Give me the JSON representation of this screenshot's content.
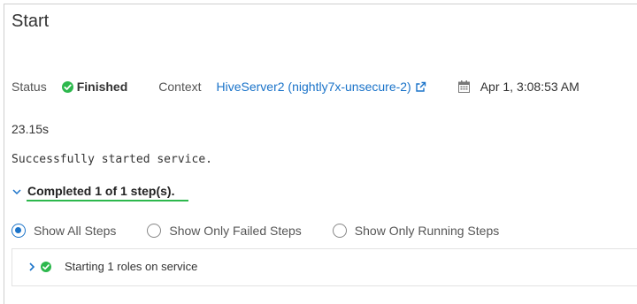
{
  "title": "Start",
  "status": {
    "label": "Status",
    "value": "Finished",
    "icon": "check-circle-icon",
    "color": "#2db84d"
  },
  "context": {
    "label": "Context",
    "link_text": "HiveServer2 (nightly7x-unsecure-2)",
    "icon": "external-link-icon",
    "link_color": "#1a73c9"
  },
  "timestamp": {
    "icon": "calendar-icon",
    "value": "Apr 1, 3:08:53 AM"
  },
  "duration": "23.15s",
  "message": "Successfully started service.",
  "completed": {
    "text": "Completed 1 of 1 step(s).",
    "expanded": true
  },
  "filters": {
    "options": [
      {
        "label": "Show All Steps",
        "checked": true
      },
      {
        "label": "Show Only Failed Steps",
        "checked": false
      },
      {
        "label": "Show Only Running Steps",
        "checked": false
      }
    ]
  },
  "steps": [
    {
      "label": "Starting 1 roles on service",
      "status": "success"
    }
  ]
}
